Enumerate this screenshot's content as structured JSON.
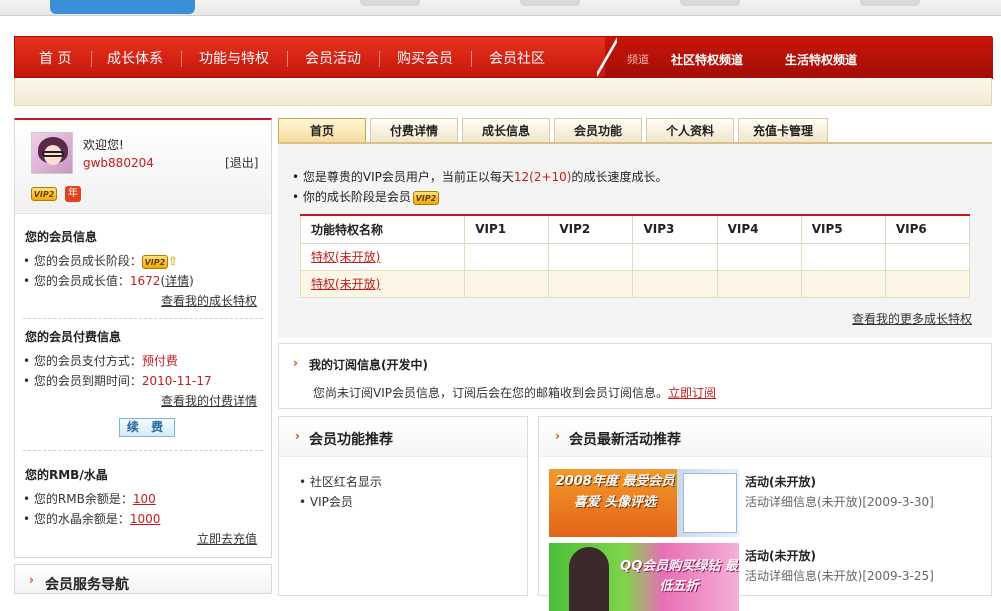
{
  "nav": {
    "items": [
      "首 页",
      "成长体系",
      "功能与特权",
      "会员活动",
      "购买会员",
      "会员社区"
    ],
    "shortcut_label": "频道",
    "right_links": [
      "社区特权频道",
      "生活特权频道"
    ]
  },
  "profile": {
    "welcome": "欢迎您!",
    "username": "gwb880204",
    "logout_open": "[",
    "logout": "退出",
    "logout_close": "]",
    "vip_badge": "VIP2",
    "year_badge": "年"
  },
  "member_info": {
    "heading": "您的会员信息",
    "stage_label": "• 您的会员成长阶段：",
    "growth_label": "• 您的会员成长值：",
    "growth_value": "1672",
    "detail_open": "(",
    "detail": "详情",
    "detail_close": ")",
    "link": "查看我的成长特权"
  },
  "payment_info": {
    "heading": "您的会员付费信息",
    "method_label": "• 您的会员支付方式：",
    "method_value": "预付费",
    "expire_label": "• 您的会员到期时间：",
    "expire_value": "2010-11-17",
    "link": "查看我的付费详情",
    "renew_button": "续 费"
  },
  "balance": {
    "heading": "您的RMB/水晶",
    "rmb_label": "• 您的RMB余额是：",
    "rmb_value": "100",
    "crystal_label": "• 您的水晶余额是：",
    "crystal_value": "1000",
    "link": "立即去充值"
  },
  "service_nav": {
    "title": "会员服务导航"
  },
  "tabs": [
    "首页",
    "付费详情",
    "成长信息",
    "会员功能",
    "个人资料",
    "充值卡管理"
  ],
  "growth": {
    "line1_prefix": "• 您是尊贵的VIP会员用户，当前正以每天",
    "line1_value": "12(2+10)",
    "line1_suffix": "的成长速度成长。",
    "line2_prefix": "• 你的成长阶段是会员",
    "table_headers": [
      "功能特权名称",
      "VIP1",
      "VIP2",
      "VIP3",
      "VIP4",
      "VIP5",
      "VIP6"
    ],
    "table_rows": [
      "特权(未开放)",
      "特权(未开放)"
    ],
    "more_link": "查看我的更多成长特权"
  },
  "subscription": {
    "title": "我的订阅信息(开发中)",
    "desc": "您尚未订阅VIP会员信息，订阅后会在您的邮箱收到会员订阅信息。",
    "link": "立即订阅"
  },
  "features": {
    "title": "会员功能推荐",
    "items": [
      "• 社区红名显示",
      "• VIP会员"
    ]
  },
  "activities": {
    "title": "会员最新活动推荐",
    "items": [
      {
        "title": "活动(未开放)",
        "desc": "活动详细信息(未开放)[2009-3-30]",
        "banner": "2008年度 最受会员喜爱 头像评选"
      },
      {
        "title": "活动(未开放)",
        "desc": "活动详细信息(未开放)[2009-3-25]",
        "banner": "QQ会员购买绿钻 最低五折"
      }
    ]
  },
  "arrow_glyph": "›",
  "colors": {
    "brand_red": "#c9161f",
    "link_red": "#c81b1b",
    "accent_orange": "#e2421e",
    "vip_gold": "#f2a900"
  }
}
